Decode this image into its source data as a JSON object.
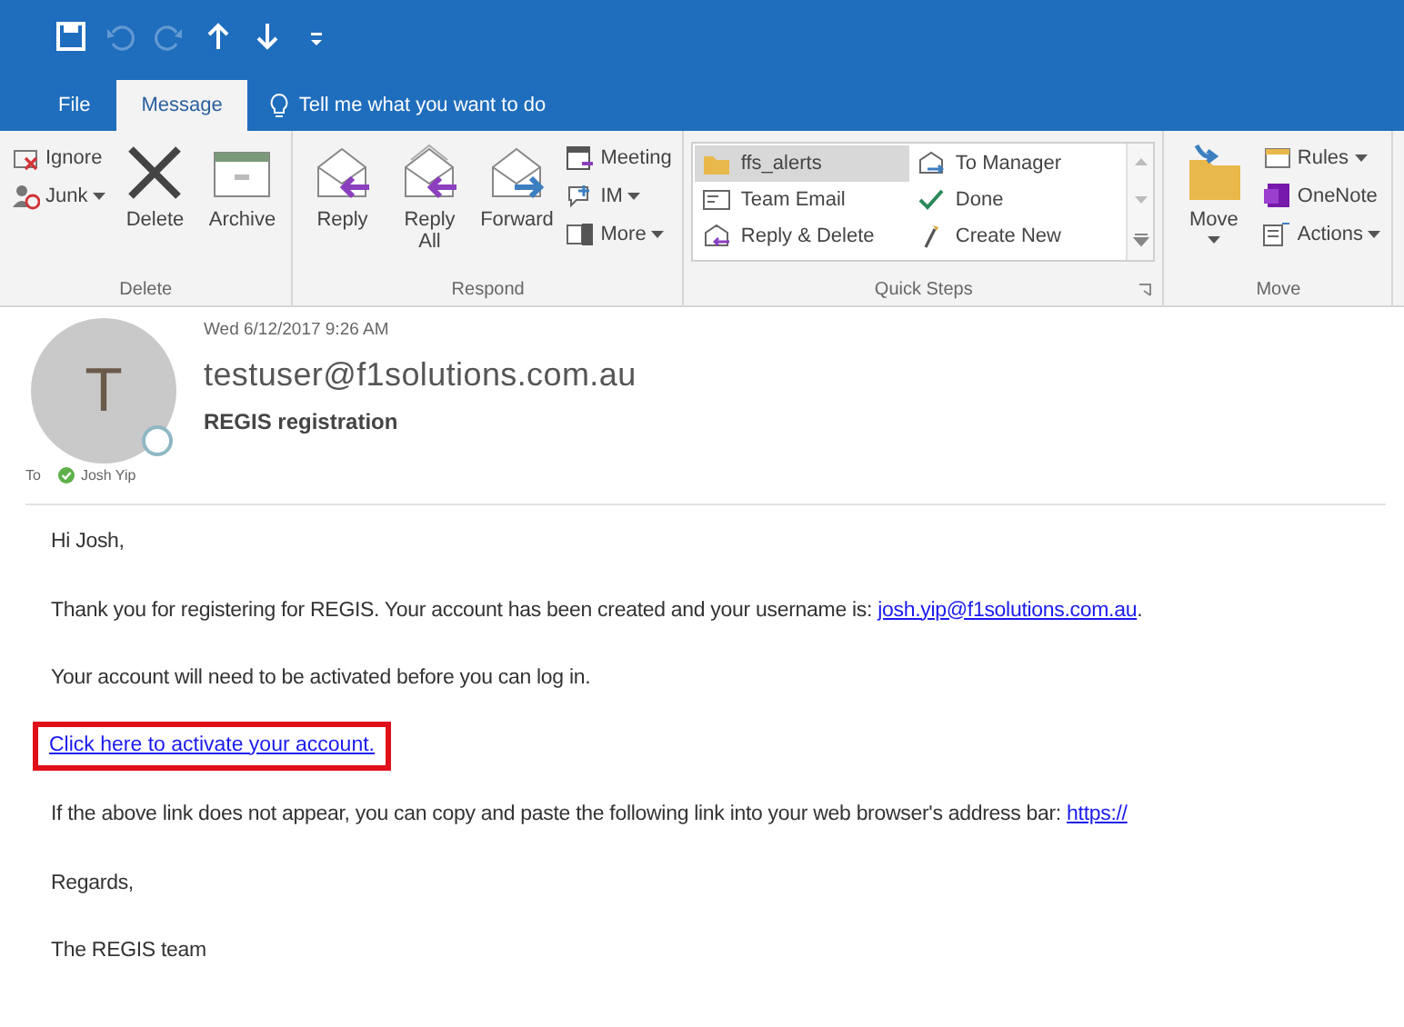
{
  "quick_access": [
    {
      "kind": "save",
      "disabled": false
    },
    {
      "kind": "undo",
      "disabled": true
    },
    {
      "kind": "redo",
      "disabled": true
    },
    {
      "kind": "up",
      "disabled": false
    },
    {
      "kind": "down",
      "disabled": false
    },
    {
      "kind": "customize",
      "disabled": false
    }
  ],
  "tabs": [
    {
      "label": "File",
      "selected": false
    },
    {
      "label": "Message",
      "selected": true
    }
  ],
  "tell_me": "Tell me what you want to do",
  "ribbon": [
    {
      "label": "Delete",
      "items": [
        {
          "kind": "small_stack",
          "buttons": [
            {
              "label": "Ignore",
              "dropdown": false
            },
            {
              "label": "Junk",
              "dropdown": true
            }
          ]
        },
        {
          "kind": "large",
          "label": "Delete",
          "dropdown": false
        },
        {
          "kind": "large",
          "label": "Archive",
          "dropdown": false
        }
      ]
    },
    {
      "label": "Respond",
      "items": [
        {
          "kind": "large",
          "label": "Reply",
          "dropdown": false
        },
        {
          "kind": "large",
          "label": "Reply All",
          "dropdown": false
        },
        {
          "kind": "large",
          "label": "Forward",
          "dropdown": false
        },
        {
          "kind": "small_stack",
          "buttons": [
            {
              "label": "Meeting",
              "dropdown": false
            },
            {
              "label": "IM",
              "dropdown": true
            },
            {
              "label": "More",
              "dropdown": true
            }
          ]
        }
      ]
    },
    {
      "label": "Quick Steps",
      "launcher": true,
      "items": [
        {
          "kind": "gallery",
          "steps": [
            {
              "label": "ffs_alerts",
              "selected": true
            },
            {
              "label": "Team Email",
              "selected": false
            },
            {
              "label": "Reply & Delete",
              "selected": false
            },
            {
              "label": "To Manager",
              "selected": false
            },
            {
              "label": "Done",
              "selected": false
            },
            {
              "label": "Create New",
              "selected": false
            }
          ]
        }
      ]
    },
    {
      "label": "Move",
      "items": [
        {
          "kind": "large",
          "label": "Move",
          "dropdown": true
        },
        {
          "kind": "small_stack",
          "buttons": [
            {
              "label": "Rules",
              "dropdown": true
            },
            {
              "label": "OneNote",
              "dropdown": false
            },
            {
              "label": "Actions",
              "dropdown": true
            }
          ]
        }
      ]
    }
  ],
  "message": {
    "avatar_letter": "T",
    "date": "Wed 6/12/2017 9:26 AM",
    "sender": "testuser@f1solutions.com.au",
    "subject": "REGIS registration",
    "to_label": "To",
    "recipients": [
      {
        "name": "Josh Yip",
        "online": true
      }
    ]
  },
  "body": [
    {
      "kind": "text",
      "text": "Hi Josh,"
    },
    {
      "kind": "text_link",
      "text": "Thank you for registering for REGIS.  Your account has been created and your username is: ",
      "link": "josh.yip@f1solutions.com.au",
      "after": "."
    },
    {
      "kind": "text",
      "text": "Your account will need to be activated before you can log in."
    },
    {
      "kind": "link",
      "link": "Click here to activate your account.",
      "highlighted": true
    },
    {
      "kind": "text_link",
      "text": "If the above link does not appear, you can copy and paste the following link into your web browser's address bar: ",
      "link": "https://"
    },
    {
      "kind": "text",
      "text": "Regards,"
    },
    {
      "kind": "text",
      "text": "The REGIS team"
    }
  ]
}
